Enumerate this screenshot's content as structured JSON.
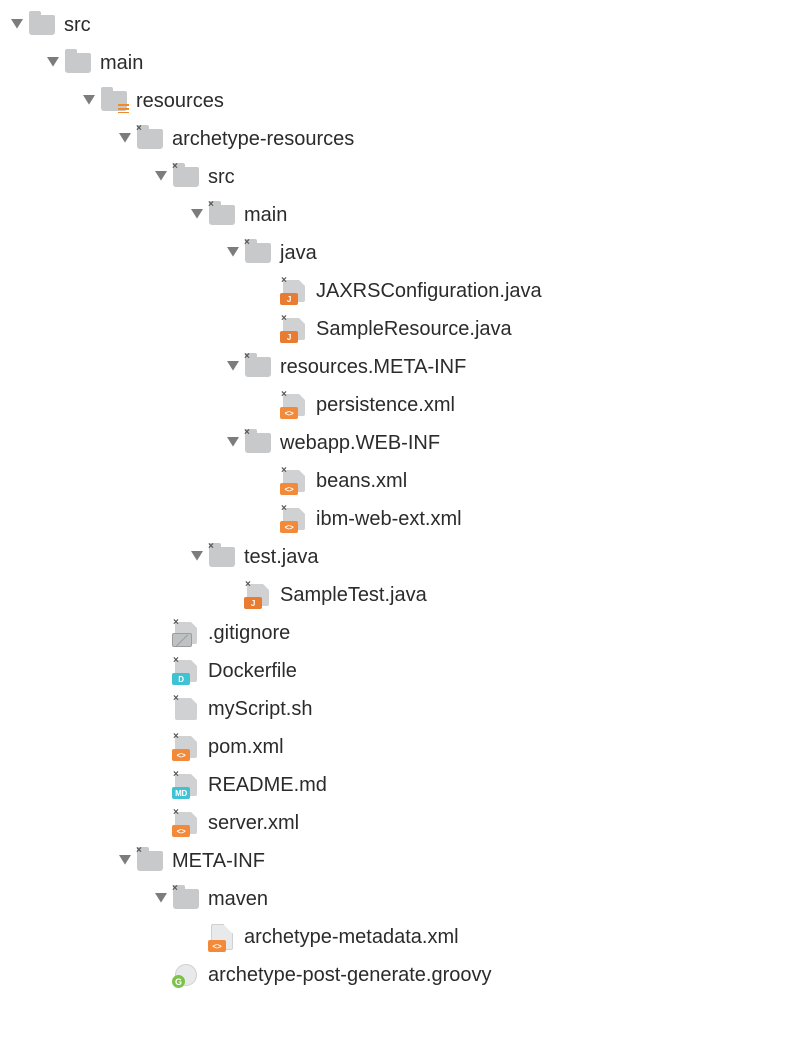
{
  "tree": [
    {
      "depth": 0,
      "expanded": true,
      "icon": "folder",
      "label": "src"
    },
    {
      "depth": 1,
      "expanded": true,
      "icon": "folder",
      "label": "main"
    },
    {
      "depth": 2,
      "expanded": true,
      "icon": "folder-res",
      "label": "resources"
    },
    {
      "depth": 3,
      "expanded": true,
      "icon": "folder-x",
      "label": "archetype-resources"
    },
    {
      "depth": 4,
      "expanded": true,
      "icon": "folder-x",
      "label": "src"
    },
    {
      "depth": 5,
      "expanded": true,
      "icon": "folder-x",
      "label": "main"
    },
    {
      "depth": 6,
      "expanded": true,
      "icon": "folder-x",
      "label": "java"
    },
    {
      "depth": 7,
      "expanded": null,
      "icon": "file-x-j",
      "label": "JAXRSConfiguration.java"
    },
    {
      "depth": 7,
      "expanded": null,
      "icon": "file-x-j",
      "label": "SampleResource.java"
    },
    {
      "depth": 6,
      "expanded": true,
      "icon": "folder-x",
      "label": "resources.META-INF"
    },
    {
      "depth": 7,
      "expanded": null,
      "icon": "file-x-xml",
      "label": "persistence.xml"
    },
    {
      "depth": 6,
      "expanded": true,
      "icon": "folder-x",
      "label": "webapp.WEB-INF"
    },
    {
      "depth": 7,
      "expanded": null,
      "icon": "file-x-xml",
      "label": "beans.xml"
    },
    {
      "depth": 7,
      "expanded": null,
      "icon": "file-x-xml",
      "label": "ibm-web-ext.xml"
    },
    {
      "depth": 5,
      "expanded": true,
      "icon": "folder-x",
      "label": "test.java"
    },
    {
      "depth": 6,
      "expanded": null,
      "icon": "file-x-j",
      "label": "SampleTest.java"
    },
    {
      "depth": 4,
      "expanded": null,
      "icon": "file-x-no",
      "label": ".gitignore"
    },
    {
      "depth": 4,
      "expanded": null,
      "icon": "file-x-d",
      "label": "Dockerfile"
    },
    {
      "depth": 4,
      "expanded": null,
      "icon": "file-x",
      "label": "myScript.sh"
    },
    {
      "depth": 4,
      "expanded": null,
      "icon": "file-x-xml",
      "label": "pom.xml"
    },
    {
      "depth": 4,
      "expanded": null,
      "icon": "file-x-md",
      "label": "README.md"
    },
    {
      "depth": 4,
      "expanded": null,
      "icon": "file-x-xml",
      "label": "server.xml"
    },
    {
      "depth": 3,
      "expanded": true,
      "icon": "folder-x",
      "label": "META-INF"
    },
    {
      "depth": 4,
      "expanded": true,
      "icon": "folder-x",
      "label": "maven"
    },
    {
      "depth": 5,
      "expanded": null,
      "icon": "page-xml",
      "label": "archetype-metadata.xml"
    },
    {
      "depth": 4,
      "expanded": null,
      "icon": "groovy",
      "label": "archetype-post-generate.groovy"
    }
  ]
}
